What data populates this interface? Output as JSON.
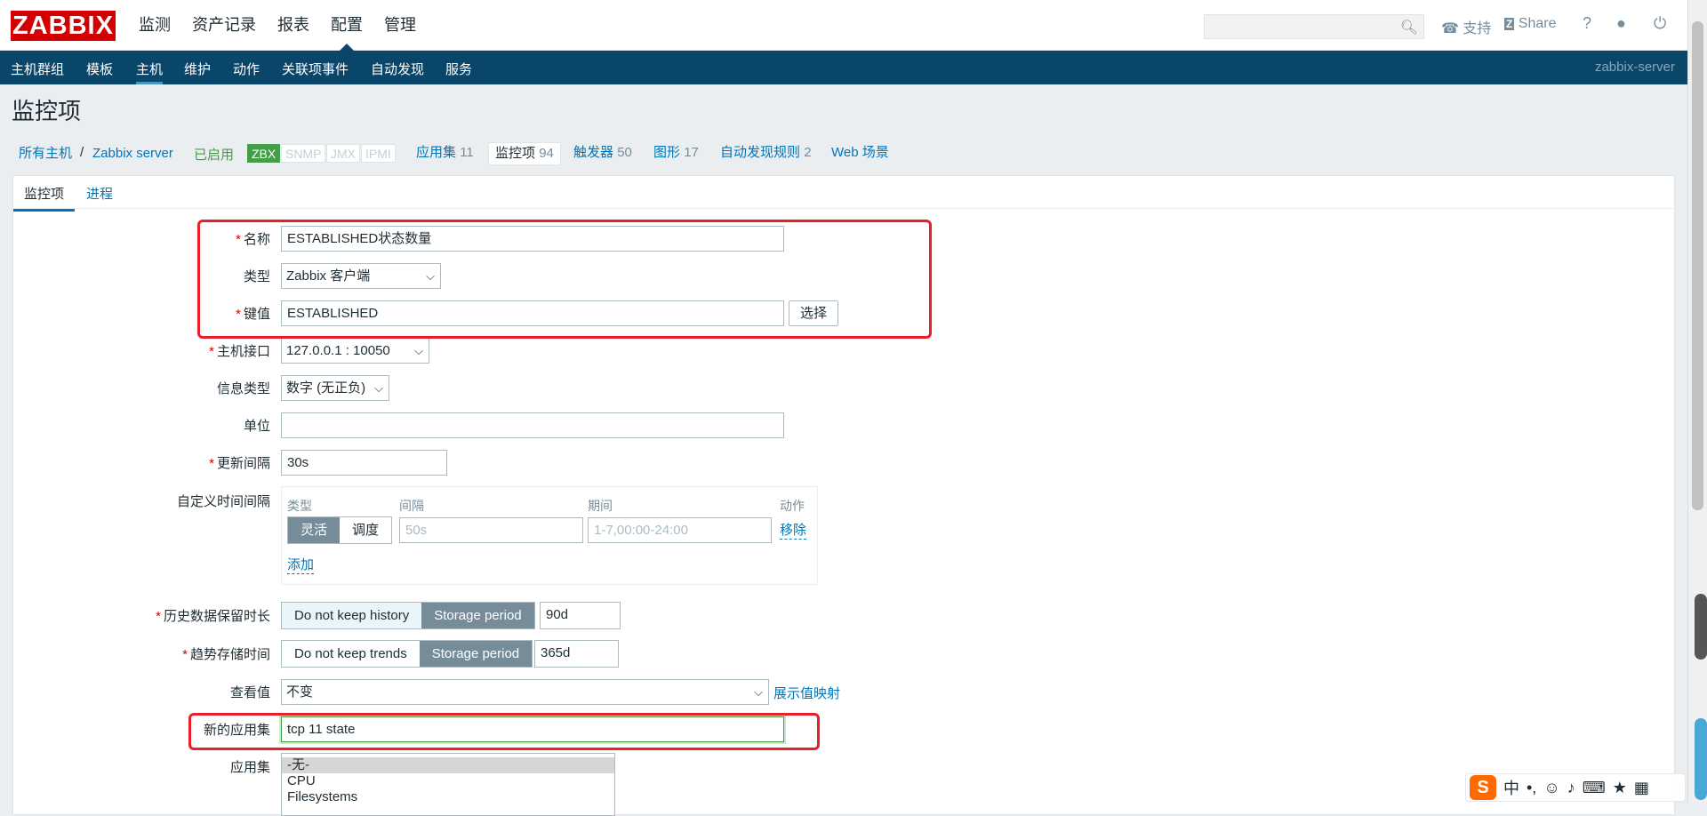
{
  "logo": "ZABBIX",
  "main_menu": [
    "监测",
    "资产记录",
    "报表",
    "配置",
    "管理"
  ],
  "top_links": {
    "support": "支持",
    "share": "Share",
    "help": "?"
  },
  "sub_nav": [
    "主机群组",
    "模板",
    "主机",
    "维护",
    "动作",
    "关联项事件",
    "自动发现",
    "服务"
  ],
  "server_name": "zabbix-server",
  "page_title": "监控项",
  "breadcrumbs": {
    "all_hosts": "所有主机",
    "separator": "/",
    "host": "Zabbix server",
    "status": "已启用",
    "availability": [
      "ZBX",
      "SNMP",
      "JMX",
      "IPMI"
    ],
    "tabs": [
      {
        "label": "应用集",
        "count": "11"
      },
      {
        "label": "监控项",
        "count": "94"
      },
      {
        "label": "触发器",
        "count": "50"
      },
      {
        "label": "图形",
        "count": "17"
      },
      {
        "label": "自动发现规则",
        "count": "2"
      },
      {
        "label": "Web 场景",
        "count": ""
      }
    ]
  },
  "form_tabs": [
    "监控项",
    "进程"
  ],
  "form": {
    "name_label": "名称",
    "name_value": "ESTABLISHED状态数量",
    "type_label": "类型",
    "type_value": "Zabbix 客户端",
    "key_label": "键值",
    "key_value": "ESTABLISHED",
    "select_button": "选择",
    "interface_label": "主机接口",
    "interface_value": "127.0.0.1 : 10050",
    "info_type_label": "信息类型",
    "info_type_value": "数字 (无正负)",
    "units_label": "单位",
    "units_value": "",
    "interval_label": "更新间隔",
    "interval_value": "30s",
    "custom_label": "自定义时间间隔",
    "custom_headers": {
      "type": "类型",
      "interval": "间隔",
      "period": "期间",
      "action": "动作"
    },
    "custom_type_options": [
      "灵活",
      "调度"
    ],
    "custom_interval_placeholder": "50s",
    "custom_period_placeholder": "1-7,00:00-24:00",
    "custom_remove": "移除",
    "custom_add": "添加",
    "history_label": "历史数据保留时长",
    "history_options": [
      "Do not keep history",
      "Storage period"
    ],
    "history_value": "90d",
    "trends_label": "趋势存储时间",
    "trends_options": [
      "Do not keep trends",
      "Storage period"
    ],
    "trends_value": "365d",
    "valuemap_label": "查看值",
    "valuemap_value": "不变",
    "valuemap_link": "展示值映射",
    "new_app_label": "新的应用集",
    "new_app_value": "tcp 11 state",
    "apps_label": "应用集",
    "apps_options": [
      "-无-",
      "CPU",
      "Filesystems"
    ]
  },
  "colors": {
    "brand": "#d40000",
    "nav": "#0a466a",
    "link": "#0275b8",
    "enabled": "#429e47",
    "highlight": "#e8202a"
  }
}
